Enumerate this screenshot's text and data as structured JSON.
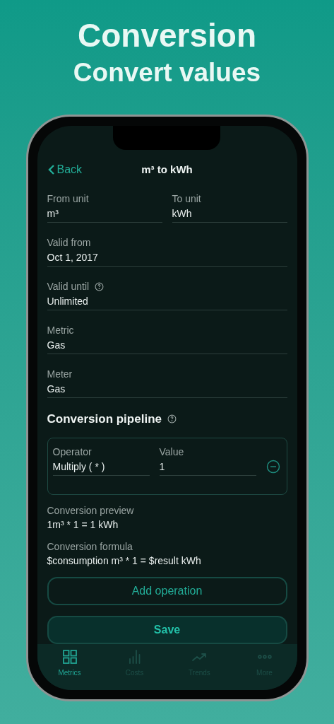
{
  "header": {
    "title": "Conversion",
    "subtitle": "Convert values"
  },
  "nav": {
    "back": "Back",
    "title": "m³ to kWh"
  },
  "unit_fields": [
    {
      "label": "From unit",
      "value": "m³"
    },
    {
      "label": "To unit",
      "value": "kWh"
    }
  ],
  "fields": [
    {
      "label": "Valid from",
      "value": "Oct 1, 2017",
      "help": false
    },
    {
      "label": "Valid until",
      "value": "Unlimited",
      "help": true
    },
    {
      "label": "Metric",
      "value": "Gas",
      "help": false
    },
    {
      "label": "Meter",
      "value": "Gas",
      "help": false
    }
  ],
  "pipeline": {
    "title": "Conversion pipeline",
    "operations": [
      {
        "operator_label": "Operator",
        "operator": "Multiply ( * )",
        "value_label": "Value",
        "value": "1"
      }
    ]
  },
  "preview": {
    "label": "Conversion preview",
    "value": "1m³ * 1 = 1 kWh"
  },
  "formula": {
    "label": "Conversion formula",
    "value": "$consumption m³ * 1 = $result kWh"
  },
  "buttons": {
    "add_operation": "Add operation",
    "save": "Save"
  },
  "tabs": [
    {
      "label": "Metrics",
      "kind": "grid",
      "selected": true
    },
    {
      "label": "Costs",
      "kind": "bars",
      "selected": false
    },
    {
      "label": "Trends",
      "kind": "trend",
      "selected": false
    },
    {
      "label": "More",
      "kind": "dots",
      "selected": false
    }
  ]
}
